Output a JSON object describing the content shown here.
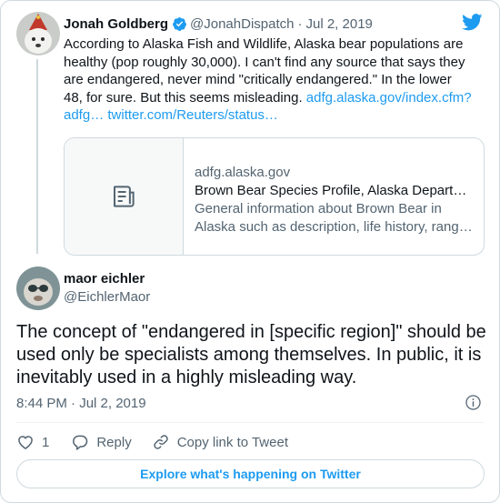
{
  "parent_tweet": {
    "name": "Jonah Goldberg",
    "handle": "@JonahDispatch",
    "separator": "·",
    "date": "Jul 2, 2019",
    "text_main": "According to Alaska Fish and Wildlife, Alaska bear populations are healthy (pop roughly 30,000). I can't find any source that says they are endangered, never mind \"critically endangered.\" In the lower 48, for sure. But this seems misleading. ",
    "link1": "adfg.alaska.gov/index.cfm?adfg…",
    "link2": "twitter.com/Reuters/status…",
    "link_card": {
      "domain": "adfg.alaska.gov",
      "title": "Brown Bear Species Profile, Alaska Department of Fish and Game",
      "description": "General information about Brown Bear in Alaska such as description, life history, range and diet"
    }
  },
  "main_tweet": {
    "name": "maor eichler",
    "handle": "@EichlerMaor",
    "text": "The concept of \"endangered in [specific region]\" should be used only be specialists among themselves. In public, it is inevitably used in a highly misleading way.",
    "timestamp": "8:44 PM · Jul 2, 2019"
  },
  "actions": {
    "like_count": "1",
    "reply_label": "Reply",
    "copy_link_label": "Copy link to Tweet"
  },
  "explore_label": "Explore what's happening on Twitter",
  "icons": {
    "verified": "verified-badge-icon",
    "brand": "twitter-bird-icon",
    "info": "info-icon",
    "like": "heart-icon",
    "reply": "reply-bubble-icon",
    "copy_link": "link-icon",
    "link_card": "document-icon"
  },
  "colors": {
    "accent": "#1d9bf0",
    "text": "#0f1419",
    "secondary": "#536471",
    "border": "#cfd9de"
  }
}
